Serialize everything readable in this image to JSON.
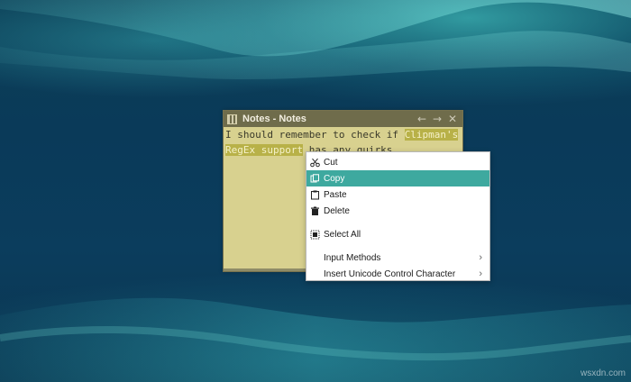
{
  "background": {
    "watermark": "wsxdn.com",
    "accent": "#3ea99f"
  },
  "notes_window": {
    "title": "Notes - Notes",
    "buttons": {
      "back": "←",
      "forward": "→",
      "close": "✕"
    },
    "text": {
      "before": "I should remember to check if ",
      "selected": "Clipman's RegEx support",
      "after": " has any quirks."
    },
    "colors": {
      "paper": "#d8d18f",
      "titlebar": "#6f6c4b",
      "selection": "#b8b148"
    }
  },
  "context_menu": {
    "items": [
      {
        "label": "Cut",
        "icon": "cut-icon",
        "active": false,
        "submenu": false
      },
      {
        "label": "Copy",
        "icon": "copy-icon",
        "active": true,
        "submenu": false
      },
      {
        "label": "Paste",
        "icon": "paste-icon",
        "active": false,
        "submenu": false
      },
      {
        "label": "Delete",
        "icon": "delete-icon",
        "active": false,
        "submenu": false
      },
      {
        "label": "Select All",
        "icon": "select-all-icon",
        "active": false,
        "submenu": false
      },
      {
        "label": "Input Methods",
        "icon": "",
        "active": false,
        "submenu": true
      },
      {
        "label": "Insert Unicode Control Character",
        "icon": "",
        "active": false,
        "submenu": true
      }
    ]
  }
}
